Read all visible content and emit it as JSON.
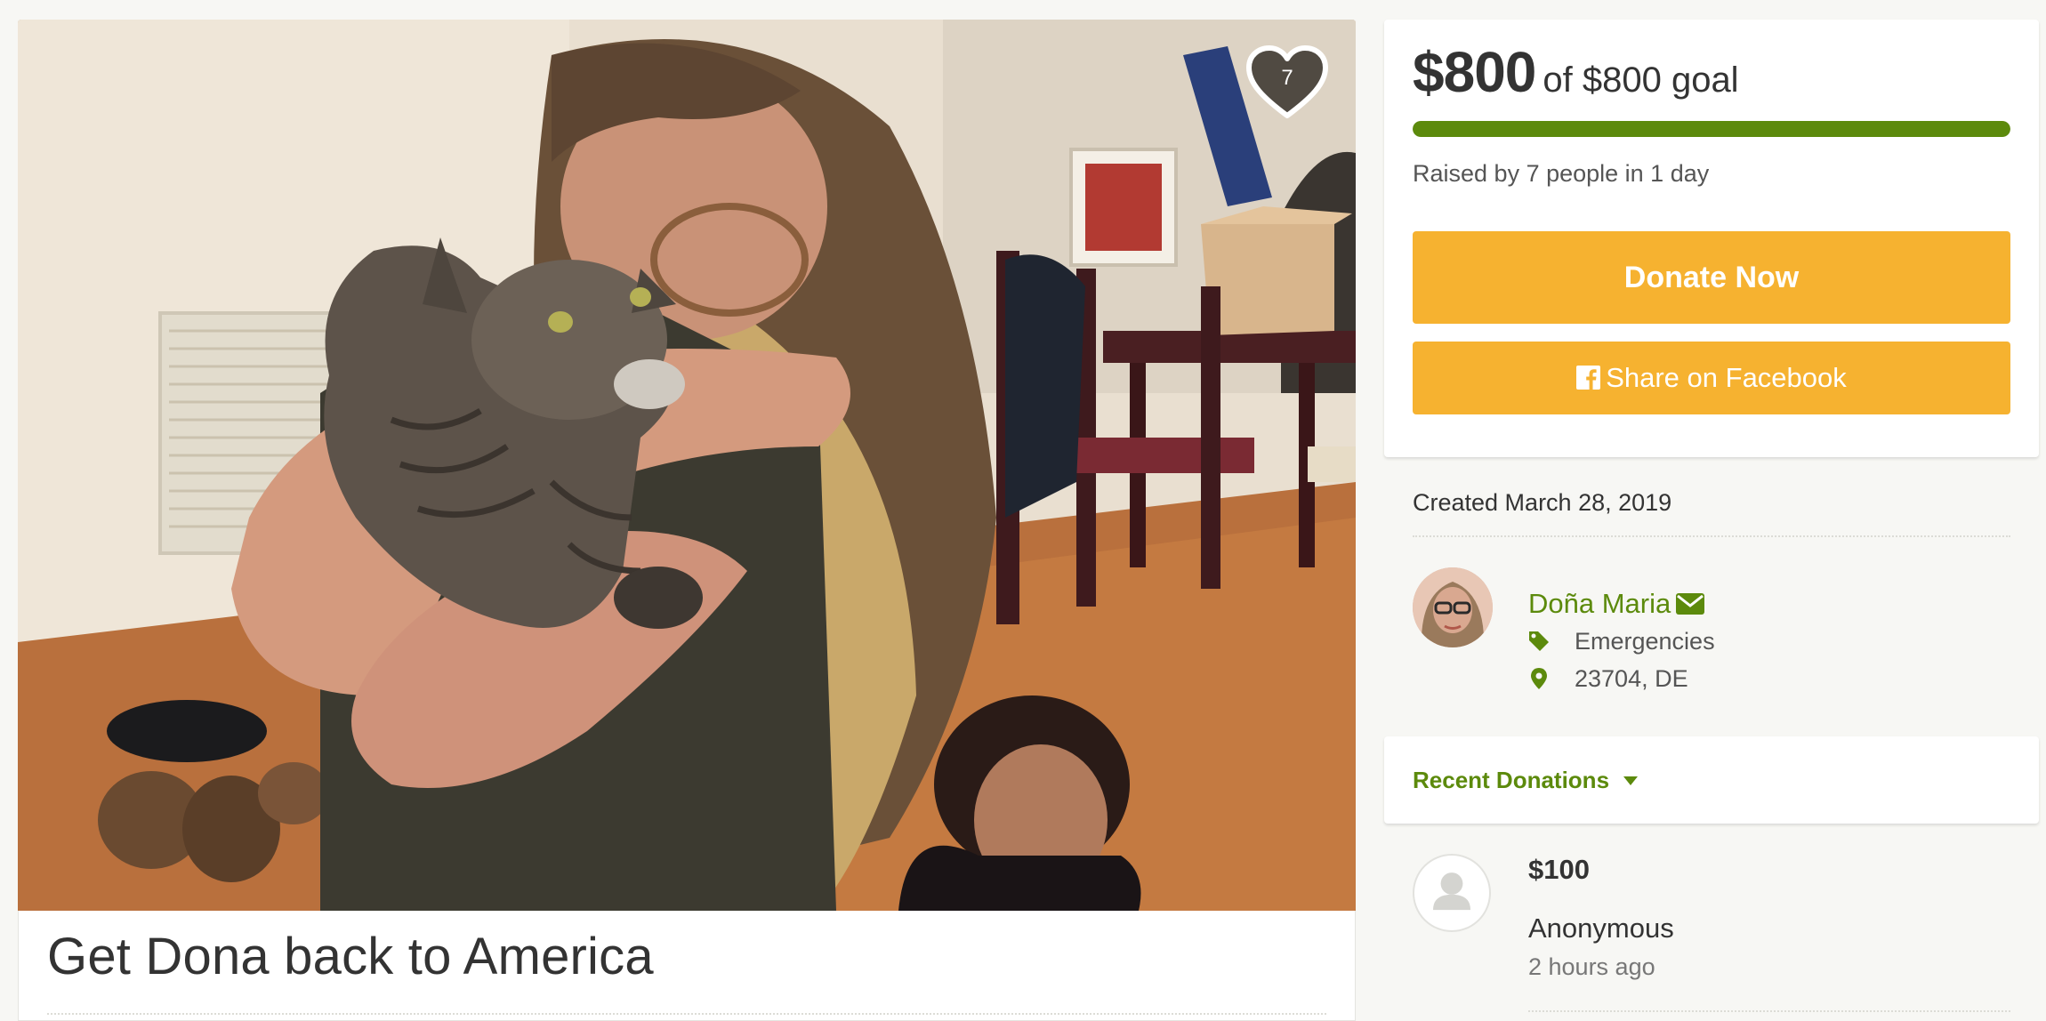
{
  "campaign": {
    "title": "Get Dona back to America",
    "photo_alt": "Campaign photo",
    "heart_count": "7"
  },
  "goal": {
    "raised": "$800",
    "goal_text": "of $800 goal",
    "progress_fraction": 1.0,
    "raised_by": "Raised by 7 people in 1 day"
  },
  "actions": {
    "donate_label": "Donate Now",
    "share_label": "Share on Facebook"
  },
  "details": {
    "created": "Created March 28, 2019",
    "organizer_name": "Doña Maria",
    "category": "Emergencies",
    "location": "23704, DE"
  },
  "donations": {
    "header": "Recent Donations",
    "items": [
      {
        "amount": "$100",
        "name": "Anonymous",
        "time": "2 hours ago"
      }
    ]
  },
  "colors": {
    "accent_green": "#5c8a0c",
    "button_yellow": "#f6b230"
  }
}
